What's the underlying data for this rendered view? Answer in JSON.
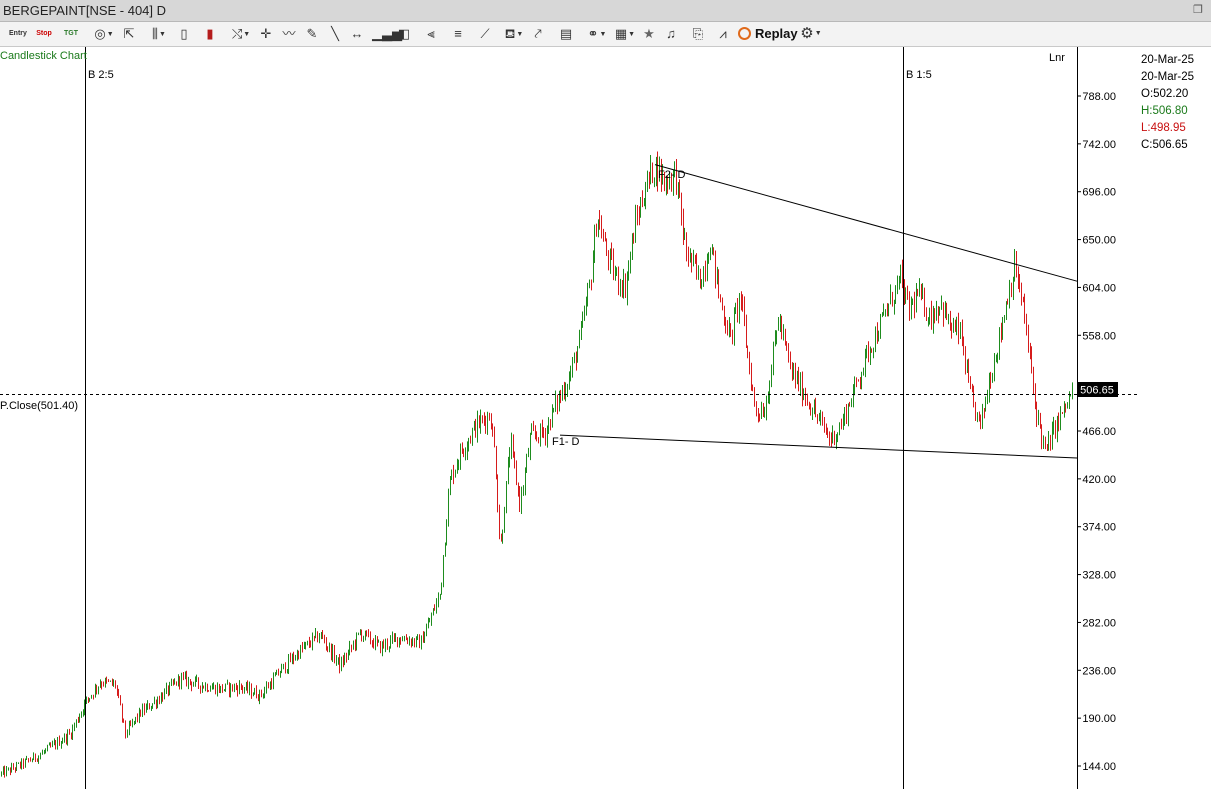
{
  "window": {
    "title": "BERGEPAINT[NSE - 404] D"
  },
  "toolbar": {
    "entry_label": "Entry",
    "stop_label": "Stop",
    "tgt_label": "TGT",
    "replay_label": "Replay",
    "icons": [
      "entry-icon",
      "stop-icon",
      "target-icon",
      "circle-tool-icon",
      "pointer-icon",
      "price-bar-icon",
      "bar-chart-icon",
      "candle-icon",
      "trend-tool-icon",
      "cursor-icon",
      "wave-icon",
      "pencil-icon",
      "line-icon",
      "horizontal-line-icon",
      "volume-icon",
      "cube-icon",
      "channel-icon",
      "parallel-lines-icon",
      "ruler-icon",
      "paint-icon",
      "edit-chart-icon",
      "page-icon",
      "link-icon",
      "layout-icon",
      "star-icon",
      "alarm-icon",
      "clipboard-icon",
      "trend-chart-icon",
      "replay-icon",
      "settings-icon"
    ]
  },
  "chart": {
    "type_label": "Candlestick Chart",
    "scale_label": "Lnr",
    "previous_close_label": "P.Close(501.40)",
    "current_price_label": "506.65",
    "markers": [
      {
        "label": "B 2:5"
      },
      {
        "label": "B 1:5"
      }
    ],
    "annotations": [
      {
        "label": "F1- D"
      },
      {
        "label": "F2- D"
      }
    ],
    "y_ticks": [
      "788.00",
      "742.00",
      "696.00",
      "650.00",
      "604.00",
      "558.00",
      "466.00",
      "420.00",
      "374.00",
      "328.00",
      "282.00",
      "236.00",
      "190.00",
      "144.00"
    ]
  },
  "ohlc": {
    "date1": "20-Mar-25",
    "date2": "20-Mar-25",
    "open": "O:502.20",
    "high": "H:506.80",
    "low": "L:498.95",
    "close": "C:506.65"
  },
  "colors": {
    "up": "#1e8c1e",
    "down": "#d61c1c",
    "trend_line": "#000000",
    "type_label": "#1a7a1a",
    "reset_icon": "#e06a1b"
  },
  "chart_data": {
    "type": "candlestick",
    "y_axis_ticks": [
      144,
      190,
      236,
      282,
      328,
      374,
      420,
      466,
      558,
      604,
      650,
      696,
      742,
      788
    ],
    "ylim": [
      125,
      808
    ],
    "previous_close": 501.4,
    "last_price": 506.65,
    "path_close": [
      [
        0,
        136
      ],
      [
        20,
        145
      ],
      [
        40,
        155
      ],
      [
        70,
        175
      ],
      [
        85,
        205
      ],
      [
        100,
        225
      ],
      [
        115,
        222
      ],
      [
        125,
        175
      ],
      [
        140,
        195
      ],
      [
        160,
        210
      ],
      [
        180,
        228
      ],
      [
        200,
        222
      ],
      [
        220,
        218
      ],
      [
        240,
        220
      ],
      [
        260,
        212
      ],
      [
        280,
        235
      ],
      [
        300,
        255
      ],
      [
        320,
        270
      ],
      [
        340,
        240
      ],
      [
        360,
        272
      ],
      [
        380,
        258
      ],
      [
        400,
        268
      ],
      [
        420,
        262
      ],
      [
        430,
        285
      ],
      [
        440,
        310
      ],
      [
        445,
        370
      ],
      [
        450,
        420
      ],
      [
        460,
        445
      ],
      [
        475,
        470
      ],
      [
        490,
        482
      ],
      [
        495,
        440
      ],
      [
        500,
        350
      ],
      [
        510,
        455
      ],
      [
        520,
        395
      ],
      [
        530,
        460
      ],
      [
        545,
        465
      ],
      [
        555,
        490
      ],
      [
        570,
        520
      ],
      [
        580,
        555
      ],
      [
        590,
        610
      ],
      [
        597,
        675
      ],
      [
        605,
        640
      ],
      [
        615,
        615
      ],
      [
        625,
        605
      ],
      [
        635,
        665
      ],
      [
        645,
        700
      ],
      [
        655,
        722
      ],
      [
        665,
        705
      ],
      [
        675,
        715
      ],
      [
        685,
        640
      ],
      [
        700,
        610
      ],
      [
        710,
        648
      ],
      [
        720,
        590
      ],
      [
        730,
        555
      ],
      [
        740,
        598
      ],
      [
        745,
        555
      ],
      [
        755,
        485
      ],
      [
        765,
        488
      ],
      [
        778,
        575
      ],
      [
        790,
        525
      ],
      [
        805,
        500
      ],
      [
        815,
        482
      ],
      [
        830,
        458
      ],
      [
        840,
        470
      ],
      [
        850,
        495
      ],
      [
        860,
        522
      ],
      [
        870,
        548
      ],
      [
        880,
        568
      ],
      [
        890,
        590
      ],
      [
        900,
        612
      ],
      [
        908,
        582
      ],
      [
        918,
        598
      ],
      [
        930,
        575
      ],
      [
        940,
        590
      ],
      [
        950,
        565
      ],
      [
        960,
        560
      ],
      [
        970,
        500
      ],
      [
        980,
        470
      ],
      [
        990,
        520
      ],
      [
        1000,
        560
      ],
      [
        1008,
        600
      ],
      [
        1015,
        625
      ],
      [
        1025,
        570
      ],
      [
        1035,
        490
      ],
      [
        1045,
        445
      ],
      [
        1055,
        470
      ],
      [
        1065,
        488
      ],
      [
        1073,
        506.65
      ]
    ],
    "trend_lines": [
      {
        "from": [
          655,
          722
        ],
        "to": [
          1077,
          610
        ]
      },
      {
        "from": [
          560,
          462
        ],
        "to": [
          1077,
          440
        ]
      }
    ],
    "volatility": 5.5
  }
}
